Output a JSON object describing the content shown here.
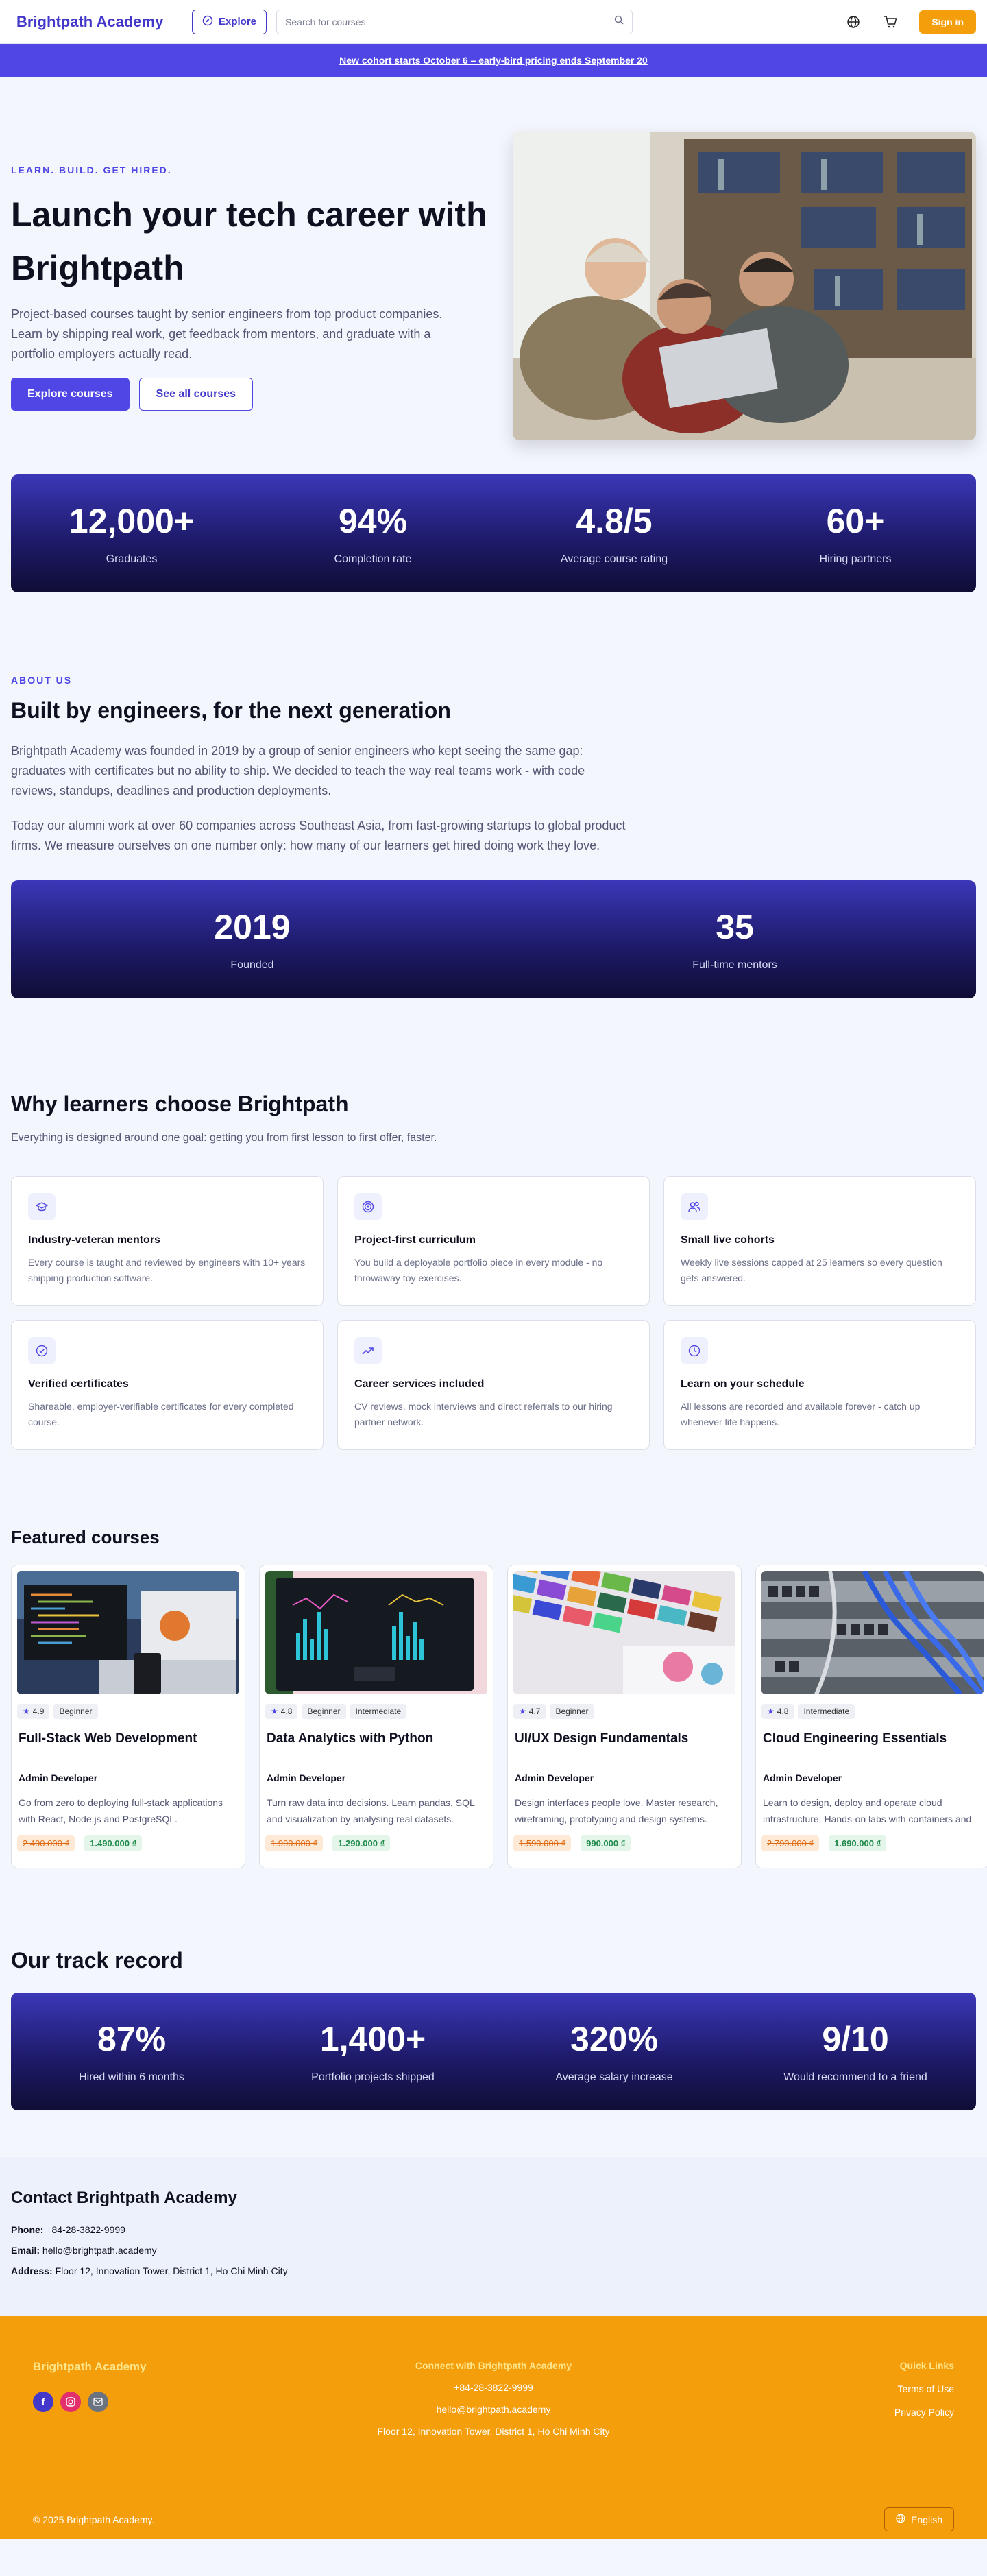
{
  "header": {
    "logo": "Brightpath Academy",
    "explore_label": "Explore",
    "search_placeholder": "Search for courses",
    "signin_label": "Sign in"
  },
  "banner": {
    "text": "New cohort starts October 6 – early-bird pricing ends September 20"
  },
  "hero": {
    "eyebrow": "LEARN. BUILD. GET HIRED.",
    "title": "Launch your tech career with Brightpath",
    "desc": "Project-based courses taught by senior engineers from top product companies. Learn by shipping real work, get feedback from mentors, and graduate with a portfolio employers actually read.",
    "primary_btn": "Explore courses",
    "secondary_btn": "See all courses"
  },
  "stats1": [
    {
      "num": "12,000+",
      "label": "Graduates"
    },
    {
      "num": "94%",
      "label": "Completion rate"
    },
    {
      "num": "4.8/5",
      "label": "Average course rating"
    },
    {
      "num": "60+",
      "label": "Hiring partners"
    }
  ],
  "about": {
    "eyebrow": "ABOUT US",
    "title": "Built by engineers, for the next generation",
    "p1": "Brightpath Academy was founded in 2019 by a group of senior engineers who kept seeing the same gap: graduates with certificates but no ability to ship. We decided to teach the way real teams work - with code reviews, standups, deadlines and production deployments.",
    "p2": "Today our alumni work at over 60 companies across Southeast Asia, from fast-growing startups to global product firms. We measure ourselves on one number only: how many of our learners get hired doing work they love."
  },
  "stats2": [
    {
      "num": "2019",
      "label": "Founded"
    },
    {
      "num": "35",
      "label": "Full-time mentors"
    }
  ],
  "why": {
    "title": "Why learners choose Brightpath",
    "sub": "Everything is designed around one goal: getting you from first lesson to first offer, faster.",
    "cards": [
      {
        "icon": "graduation-cap-icon",
        "title": "Industry-veteran mentors",
        "desc": "Every course is taught and reviewed by engineers with 10+ years shipping production software."
      },
      {
        "icon": "target-icon",
        "title": "Project-first curriculum",
        "desc": "You build a deployable portfolio piece in every module - no throwaway toy exercises."
      },
      {
        "icon": "users-icon",
        "title": "Small live cohorts",
        "desc": "Weekly live sessions capped at 25 learners so every question gets answered."
      },
      {
        "icon": "check-circle-icon",
        "title": "Verified certificates",
        "desc": "Shareable, employer-verifiable certificates for every completed course."
      },
      {
        "icon": "trending-up-icon",
        "title": "Career services included",
        "desc": "CV reviews, mock interviews and direct referrals to our hiring partner network."
      },
      {
        "icon": "clock-icon",
        "title": "Learn on your schedule",
        "desc": "All lessons are recorded and available forever - catch up whenever life happens."
      }
    ]
  },
  "courses": {
    "title": "Featured courses",
    "items": [
      {
        "rating": "4.9",
        "tags": [
          "Beginner"
        ],
        "title": "Full-Stack Web Development",
        "instructor": "Admin Developer",
        "desc": "Go from zero to deploying full-stack applications with React, Node.js and PostgreSQL.",
        "old_price": "2.490.000 ₫",
        "new_price": "1.490.000 ₫"
      },
      {
        "rating": "4.8",
        "tags": [
          "Beginner",
          "Intermediate"
        ],
        "title": "Data Analytics with Python",
        "instructor": "Admin Developer",
        "desc": "Turn raw data into decisions. Learn pandas, SQL and visualization by analysing real datasets.",
        "old_price": "1.990.000 ₫",
        "new_price": "1.290.000 ₫"
      },
      {
        "rating": "4.7",
        "tags": [
          "Beginner"
        ],
        "title": "UI/UX Design Fundamentals",
        "instructor": "Admin Developer",
        "desc": "Design interfaces people love. Master research, wireframing, prototyping and design systems.",
        "old_price": "1.590.000 ₫",
        "new_price": "990.000 ₫"
      },
      {
        "rating": "4.8",
        "tags": [
          "Intermediate"
        ],
        "title": "Cloud Engineering Essentials",
        "instructor": "Admin Developer",
        "desc": "Learn to design, deploy and operate cloud infrastructure. Hands-on labs with containers and CI/CD.",
        "old_price": "2.790.000 ₫",
        "new_price": "1.690.000 ₫"
      }
    ]
  },
  "track": {
    "title": "Our track record",
    "stats": [
      {
        "num": "87%",
        "label": "Hired within 6 months"
      },
      {
        "num": "1,400+",
        "label": "Portfolio projects shipped"
      },
      {
        "num": "320%",
        "label": "Average salary increase"
      },
      {
        "num": "9/10",
        "label": "Would recommend to a friend"
      }
    ]
  },
  "contact": {
    "title": "Contact Brightpath Academy",
    "phone_label": "Phone:",
    "phone": "+84-28-3822-9999",
    "email_label": "Email:",
    "email": "hello@brightpath.academy",
    "address_label": "Address:",
    "address": "Floor 12, Innovation Tower, District 1, Ho Chi Minh City"
  },
  "footer": {
    "brand": "Brightpath Academy",
    "connect_title": "Connect with Brightpath Academy",
    "phone": "+84-28-3822-9999",
    "email": "hello@brightpath.academy",
    "address": "Floor 12, Innovation Tower, District 1, Ho Chi Minh City",
    "links_title": "Quick Links",
    "terms": "Terms of Use",
    "privacy": "Privacy Policy",
    "copyright": "© 2025 Brightpath Academy.",
    "language": "English"
  }
}
